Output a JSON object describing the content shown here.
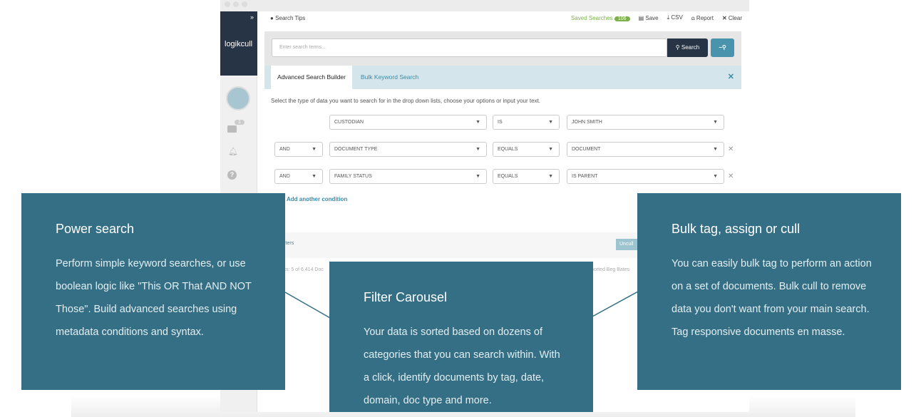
{
  "sidebar": {
    "logo": "logikcull",
    "expand": "»",
    "folder_badge": "1"
  },
  "toolbar": {
    "search_tips": "Search Tips",
    "saved_searches": "Saved Searches",
    "saved_count": "106",
    "save": "Save",
    "csv": "CSV",
    "report": "Report",
    "clear": "Clear"
  },
  "search": {
    "placeholder": "Enter search terms...",
    "button": "Search"
  },
  "builder": {
    "tabs": [
      "Advanced Search Builder",
      "Bulk Keyword Search"
    ],
    "instructions": "Select the type of data you want to search for in the drop down lists, choose your options or input your text.",
    "rows": [
      {
        "op": "",
        "field": "CUSTODIAN",
        "cmp": "IS",
        "value": "JOHN SMITH"
      },
      {
        "op": "AND",
        "field": "DOCUMENT TYPE",
        "cmp": "EQUALS",
        "value": "DOCUMENT"
      },
      {
        "op": "AND",
        "field": "FAMILY STATUS",
        "cmp": "EQUALS",
        "value": "IS PARENT"
      }
    ],
    "add_condition": "Add another condition"
  },
  "results": {
    "filters": "lters",
    "uncull": "Uncull",
    "count": "ts: 5 of 6,414 Doc",
    "sort": "ported Beg Bates"
  },
  "cards": [
    {
      "title": "Power search",
      "body": "Perform simple keyword searches, or use boolean logic like \"This OR That AND NOT Those\". Build advanced searches using metadata conditions and syntax."
    },
    {
      "title": "Filter Carousel",
      "body": "Your data is sorted based on dozens of categories that you can search within. With a click, identify documents by tag, date, domain, doc type and more."
    },
    {
      "title": "Bulk tag, assign or cull",
      "body": "You can easily bulk tag to perform an action on a set of documents. Bulk cull to remove data you don't want from your main search. Tag responsive documents en masse."
    }
  ],
  "colors": {
    "card": "#346f85",
    "navy": "#263445",
    "accent": "#3b8aa5",
    "saved": "#7bb04b"
  }
}
